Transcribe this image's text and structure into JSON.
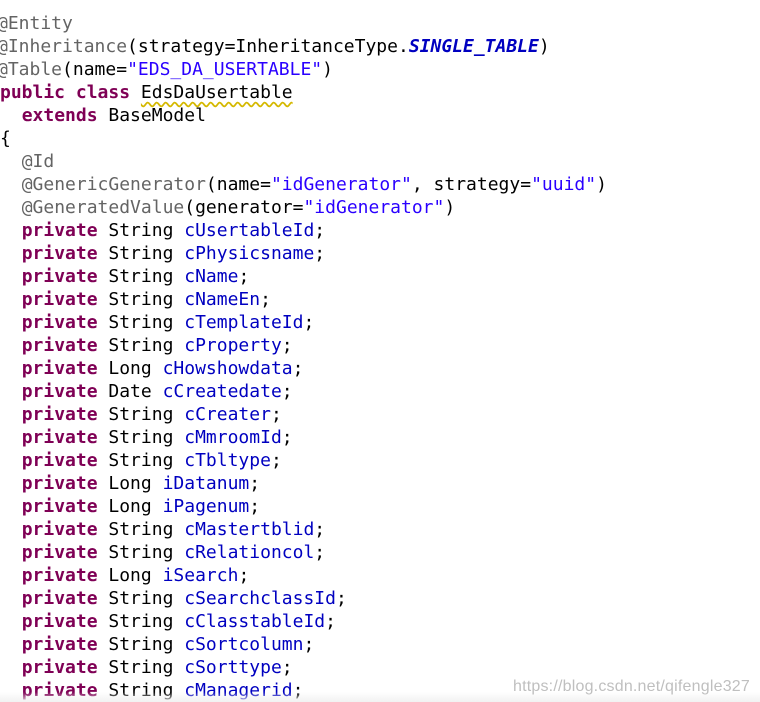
{
  "code": {
    "lines": [
      {
        "tokens": [
          {
            "t": "@Entity",
            "c": "ann"
          }
        ]
      },
      {
        "tokens": [
          {
            "t": "@Inheritance",
            "c": "ann"
          },
          {
            "t": "(strategy=InheritanceType.",
            "c": "plain"
          },
          {
            "t": "SINGLE_TABLE",
            "c": "const"
          },
          {
            "t": ")",
            "c": "plain"
          }
        ]
      },
      {
        "tokens": [
          {
            "t": "@Table",
            "c": "ann"
          },
          {
            "t": "(name=",
            "c": "plain"
          },
          {
            "t": "\"EDS_DA_USERTABLE\"",
            "c": "str"
          },
          {
            "t": ")",
            "c": "plain"
          }
        ]
      },
      {
        "tokens": [
          {
            "t": "public",
            "c": "kw"
          },
          {
            "t": " ",
            "c": "plain"
          },
          {
            "t": "class",
            "c": "kw"
          },
          {
            "t": " ",
            "c": "plain"
          },
          {
            "t": "EdsDaUsertable",
            "c": "plain",
            "warn": true
          }
        ]
      },
      {
        "tokens": [
          {
            "t": "  ",
            "c": "plain"
          },
          {
            "t": "extends",
            "c": "kw"
          },
          {
            "t": " BaseModel",
            "c": "plain"
          }
        ]
      },
      {
        "tokens": [
          {
            "t": "{",
            "c": "plain"
          }
        ]
      },
      {
        "tokens": [
          {
            "t": "  ",
            "c": "plain"
          },
          {
            "t": "@Id",
            "c": "ann"
          }
        ]
      },
      {
        "tokens": [
          {
            "t": "  ",
            "c": "plain"
          },
          {
            "t": "@GenericGenerator",
            "c": "ann"
          },
          {
            "t": "(name=",
            "c": "plain"
          },
          {
            "t": "\"idGenerator\"",
            "c": "str"
          },
          {
            "t": ", strategy=",
            "c": "plain"
          },
          {
            "t": "\"uuid\"",
            "c": "str"
          },
          {
            "t": ")",
            "c": "plain"
          }
        ]
      },
      {
        "tokens": [
          {
            "t": "  ",
            "c": "plain"
          },
          {
            "t": "@GeneratedValue",
            "c": "ann"
          },
          {
            "t": "(generator=",
            "c": "plain"
          },
          {
            "t": "\"idGenerator\"",
            "c": "str"
          },
          {
            "t": ")",
            "c": "plain"
          }
        ]
      },
      {
        "tokens": [
          {
            "t": "  ",
            "c": "plain"
          },
          {
            "t": "private",
            "c": "kw"
          },
          {
            "t": " String ",
            "c": "plain"
          },
          {
            "t": "cUsertableId",
            "c": "field"
          },
          {
            "t": ";",
            "c": "plain"
          }
        ]
      },
      {
        "tokens": [
          {
            "t": "  ",
            "c": "plain"
          },
          {
            "t": "private",
            "c": "kw"
          },
          {
            "t": " String ",
            "c": "plain"
          },
          {
            "t": "cPhysicsname",
            "c": "field"
          },
          {
            "t": ";",
            "c": "plain"
          }
        ]
      },
      {
        "tokens": [
          {
            "t": "  ",
            "c": "plain"
          },
          {
            "t": "private",
            "c": "kw"
          },
          {
            "t": " String ",
            "c": "plain"
          },
          {
            "t": "cName",
            "c": "field"
          },
          {
            "t": ";",
            "c": "plain"
          }
        ]
      },
      {
        "tokens": [
          {
            "t": "  ",
            "c": "plain"
          },
          {
            "t": "private",
            "c": "kw"
          },
          {
            "t": " String ",
            "c": "plain"
          },
          {
            "t": "cNameEn",
            "c": "field"
          },
          {
            "t": ";",
            "c": "plain"
          }
        ]
      },
      {
        "tokens": [
          {
            "t": "  ",
            "c": "plain"
          },
          {
            "t": "private",
            "c": "kw"
          },
          {
            "t": " String ",
            "c": "plain"
          },
          {
            "t": "cTemplateId",
            "c": "field"
          },
          {
            "t": ";",
            "c": "plain"
          }
        ]
      },
      {
        "tokens": [
          {
            "t": "  ",
            "c": "plain"
          },
          {
            "t": "private",
            "c": "kw"
          },
          {
            "t": " String ",
            "c": "plain"
          },
          {
            "t": "cProperty",
            "c": "field"
          },
          {
            "t": ";",
            "c": "plain"
          }
        ]
      },
      {
        "tokens": [
          {
            "t": "  ",
            "c": "plain"
          },
          {
            "t": "private",
            "c": "kw"
          },
          {
            "t": " Long ",
            "c": "plain"
          },
          {
            "t": "cHowshowdata",
            "c": "field"
          },
          {
            "t": ";",
            "c": "plain"
          }
        ]
      },
      {
        "tokens": [
          {
            "t": "  ",
            "c": "plain"
          },
          {
            "t": "private",
            "c": "kw"
          },
          {
            "t": " Date ",
            "c": "plain"
          },
          {
            "t": "cCreatedate",
            "c": "field"
          },
          {
            "t": ";",
            "c": "plain"
          }
        ]
      },
      {
        "tokens": [
          {
            "t": "  ",
            "c": "plain"
          },
          {
            "t": "private",
            "c": "kw"
          },
          {
            "t": " String ",
            "c": "plain"
          },
          {
            "t": "cCreater",
            "c": "field"
          },
          {
            "t": ";",
            "c": "plain"
          }
        ]
      },
      {
        "tokens": [
          {
            "t": "  ",
            "c": "plain"
          },
          {
            "t": "private",
            "c": "kw"
          },
          {
            "t": " String ",
            "c": "plain"
          },
          {
            "t": "cMmroomId",
            "c": "field"
          },
          {
            "t": ";",
            "c": "plain"
          }
        ]
      },
      {
        "tokens": [
          {
            "t": "  ",
            "c": "plain"
          },
          {
            "t": "private",
            "c": "kw"
          },
          {
            "t": " String ",
            "c": "plain"
          },
          {
            "t": "cTbltype",
            "c": "field"
          },
          {
            "t": ";",
            "c": "plain"
          }
        ]
      },
      {
        "tokens": [
          {
            "t": "  ",
            "c": "plain"
          },
          {
            "t": "private",
            "c": "kw"
          },
          {
            "t": " Long ",
            "c": "plain"
          },
          {
            "t": "iDatanum",
            "c": "field"
          },
          {
            "t": ";",
            "c": "plain"
          }
        ]
      },
      {
        "tokens": [
          {
            "t": "  ",
            "c": "plain"
          },
          {
            "t": "private",
            "c": "kw"
          },
          {
            "t": " Long ",
            "c": "plain"
          },
          {
            "t": "iPagenum",
            "c": "field"
          },
          {
            "t": ";",
            "c": "plain"
          }
        ]
      },
      {
        "tokens": [
          {
            "t": "  ",
            "c": "plain"
          },
          {
            "t": "private",
            "c": "kw"
          },
          {
            "t": " String ",
            "c": "plain"
          },
          {
            "t": "cMastertblid",
            "c": "field"
          },
          {
            "t": ";",
            "c": "plain"
          }
        ]
      },
      {
        "tokens": [
          {
            "t": "  ",
            "c": "plain"
          },
          {
            "t": "private",
            "c": "kw"
          },
          {
            "t": " String ",
            "c": "plain"
          },
          {
            "t": "cRelationcol",
            "c": "field"
          },
          {
            "t": ";",
            "c": "plain"
          }
        ]
      },
      {
        "tokens": [
          {
            "t": "  ",
            "c": "plain"
          },
          {
            "t": "private",
            "c": "kw"
          },
          {
            "t": " Long ",
            "c": "plain"
          },
          {
            "t": "iSearch",
            "c": "field"
          },
          {
            "t": ";",
            "c": "plain"
          }
        ]
      },
      {
        "tokens": [
          {
            "t": "  ",
            "c": "plain"
          },
          {
            "t": "private",
            "c": "kw"
          },
          {
            "t": " String ",
            "c": "plain"
          },
          {
            "t": "cSearchclassId",
            "c": "field"
          },
          {
            "t": ";",
            "c": "plain"
          }
        ]
      },
      {
        "tokens": [
          {
            "t": "  ",
            "c": "plain"
          },
          {
            "t": "private",
            "c": "kw"
          },
          {
            "t": " String ",
            "c": "plain"
          },
          {
            "t": "cClasstableId",
            "c": "field"
          },
          {
            "t": ";",
            "c": "plain"
          }
        ]
      },
      {
        "tokens": [
          {
            "t": "  ",
            "c": "plain"
          },
          {
            "t": "private",
            "c": "kw"
          },
          {
            "t": " String ",
            "c": "plain"
          },
          {
            "t": "cSortcolumn",
            "c": "field"
          },
          {
            "t": ";",
            "c": "plain"
          }
        ]
      },
      {
        "tokens": [
          {
            "t": "  ",
            "c": "plain"
          },
          {
            "t": "private",
            "c": "kw"
          },
          {
            "t": " String ",
            "c": "plain"
          },
          {
            "t": "cSorttype",
            "c": "field"
          },
          {
            "t": ";",
            "c": "plain"
          }
        ]
      },
      {
        "tokens": [
          {
            "t": "  ",
            "c": "plain"
          },
          {
            "t": "private",
            "c": "kw"
          },
          {
            "t": " String ",
            "c": "plain"
          },
          {
            "t": "cManagerid",
            "c": "field"
          },
          {
            "t": ";",
            "c": "plain"
          }
        ]
      }
    ]
  },
  "watermark": {
    "text": "https://blog.csdn.net/qifengle327"
  },
  "colors": {
    "annotation": "#646464",
    "keyword": "#7f0055",
    "string": "#2a00ff",
    "field": "#0000c0",
    "warning_underline": "#d4b800"
  }
}
